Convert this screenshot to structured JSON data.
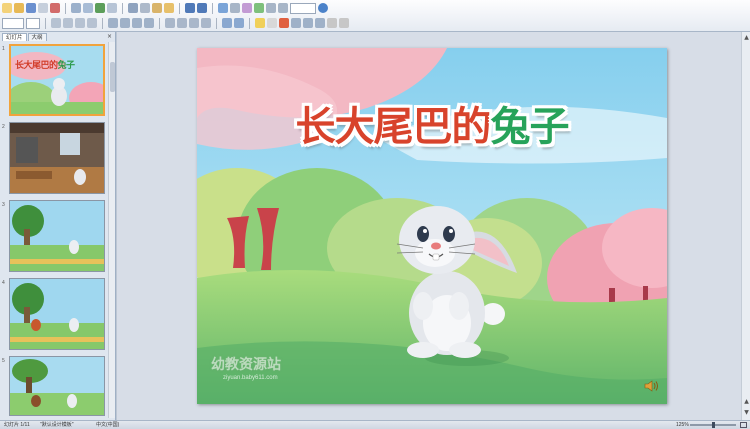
{
  "panel": {
    "tabs": [
      "幻灯片",
      "大纲"
    ],
    "close_glyph": "×",
    "slide_numbers": [
      "1",
      "2",
      "3",
      "4",
      "5"
    ],
    "thumb1_title_a": "长大尾巴的",
    "thumb1_title_b": "兔子"
  },
  "slide": {
    "title_part1": "长大尾巴的",
    "title_part2": "兔子",
    "watermark": "幼教资源站",
    "watermark_url": "ziyuan.baby611.com",
    "speaker_icon": "speaker-icon"
  },
  "status_bar": {
    "slide_indicator": "幻灯片 1/11",
    "template": "\"默认设计模板\"",
    "language": "中文(中国)",
    "zoom": "125%"
  },
  "colors": {
    "title_red": "#d8432b",
    "title_green": "#27a35a",
    "selected_border": "#f1a33c",
    "sky": "#8fd0ee"
  }
}
